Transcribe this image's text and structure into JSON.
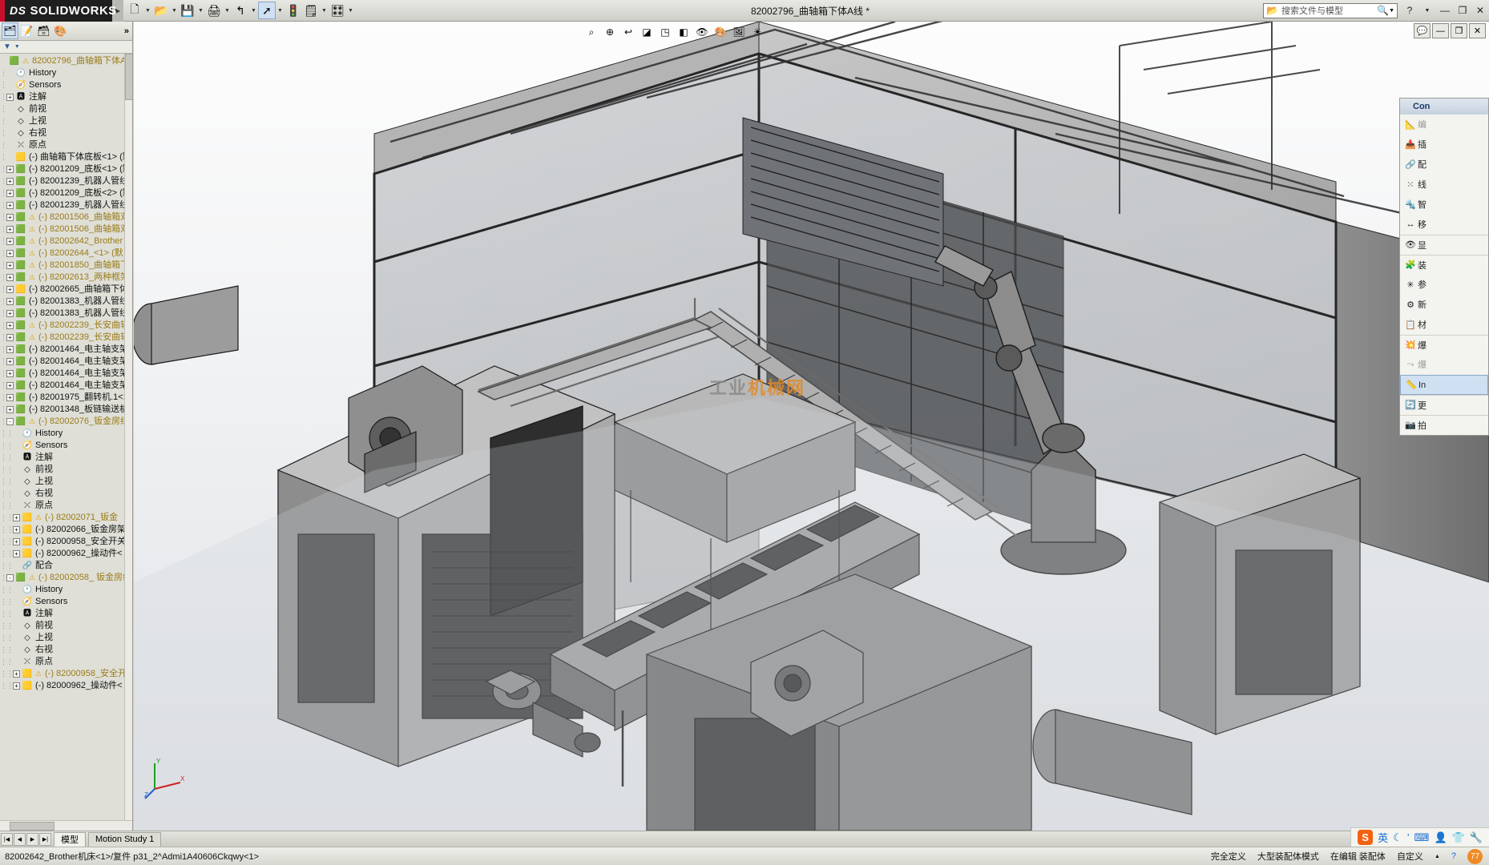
{
  "titlebar": {
    "brand": "SOLIDWORKS",
    "brand_ds": "DS",
    "document_title": "82002796_曲轴箱下体A线 *",
    "quick_tools": [
      {
        "name": "new-document",
        "glyph": "🗋"
      },
      {
        "name": "open-document",
        "glyph": "📂"
      },
      {
        "name": "save-document",
        "glyph": "💾"
      },
      {
        "name": "print-document",
        "glyph": "🖨"
      },
      {
        "name": "undo",
        "glyph": "↰"
      },
      {
        "name": "select",
        "glyph": "➚"
      },
      {
        "name": "rebuild",
        "glyph": "🚦"
      },
      {
        "name": "options",
        "glyph": "🗒"
      },
      {
        "name": "appearance",
        "glyph": "🎨"
      }
    ],
    "search_placeholder": "搜索文件与模型",
    "help_glyph": "?",
    "window_buttons": [
      "—",
      "❐",
      "✕"
    ]
  },
  "left_panel": {
    "tabs": [
      {
        "name": "feature-manager",
        "glyph": "🗂"
      },
      {
        "name": "property-manager",
        "glyph": "📝"
      },
      {
        "name": "configuration-manager",
        "glyph": "🗃"
      },
      {
        "name": "display-manager",
        "glyph": "🎨"
      }
    ],
    "more_label": "»",
    "filter_glyph": "▽"
  },
  "tree": [
    {
      "depth": 0,
      "expand": "",
      "icon": "assembly",
      "warn": true,
      "label": "82002796_曲轴箱下体A线",
      "amber": true
    },
    {
      "depth": 1,
      "expand": "",
      "icon": "history",
      "warn": false,
      "label": "History",
      "amber": false
    },
    {
      "depth": 1,
      "expand": "",
      "icon": "sensors",
      "warn": false,
      "label": "Sensors",
      "amber": false
    },
    {
      "depth": 1,
      "expand": "+",
      "icon": "annotations",
      "warn": false,
      "label": "注解",
      "amber": false
    },
    {
      "depth": 1,
      "expand": "",
      "icon": "plane",
      "warn": false,
      "label": "前视",
      "amber": false
    },
    {
      "depth": 1,
      "expand": "",
      "icon": "plane",
      "warn": false,
      "label": "上视",
      "amber": false
    },
    {
      "depth": 1,
      "expand": "",
      "icon": "plane",
      "warn": false,
      "label": "右视",
      "amber": false
    },
    {
      "depth": 1,
      "expand": "",
      "icon": "origin",
      "warn": false,
      "label": "原点",
      "amber": false
    },
    {
      "depth": 1,
      "expand": "",
      "icon": "part",
      "warn": false,
      "label": "(-) 曲轴箱下体底板<1>  (默",
      "amber": false
    },
    {
      "depth": 1,
      "expand": "+",
      "icon": "assembly",
      "warn": false,
      "label": "(-) 82001209_底板<1>  (默",
      "amber": false
    },
    {
      "depth": 1,
      "expand": "+",
      "icon": "assembly",
      "warn": false,
      "label": "(-) 82001239_机器人管线",
      "amber": false
    },
    {
      "depth": 1,
      "expand": "+",
      "icon": "assembly",
      "warn": false,
      "label": "(-) 82001209_底板<2>  (默",
      "amber": false
    },
    {
      "depth": 1,
      "expand": "+",
      "icon": "assembly",
      "warn": false,
      "label": "(-) 82001239_机器人管线",
      "amber": false
    },
    {
      "depth": 1,
      "expand": "+",
      "icon": "assembly",
      "warn": true,
      "label": "(-) 82001506_曲轴箱双",
      "amber": true
    },
    {
      "depth": 1,
      "expand": "+",
      "icon": "assembly",
      "warn": true,
      "label": "(-) 82001506_曲轴箱双",
      "amber": true
    },
    {
      "depth": 1,
      "expand": "+",
      "icon": "assembly",
      "warn": true,
      "label": "(-) 82002642_Brother",
      "amber": true
    },
    {
      "depth": 1,
      "expand": "+",
      "icon": "assembly",
      "warn": true,
      "label": "(-) 82002644_<1>  (默",
      "amber": true
    },
    {
      "depth": 1,
      "expand": "+",
      "icon": "assembly",
      "warn": true,
      "label": "(-) 82001850_曲轴箱下",
      "amber": true
    },
    {
      "depth": 1,
      "expand": "+",
      "icon": "assembly",
      "warn": true,
      "label": "(-) 82002613_两种框架",
      "amber": true
    },
    {
      "depth": 1,
      "expand": "+",
      "icon": "part",
      "warn": false,
      "label": "(-) 82002665_曲轴箱下体",
      "amber": false
    },
    {
      "depth": 1,
      "expand": "+",
      "icon": "assembly",
      "warn": false,
      "label": "(-) 82001383_机器人管线",
      "amber": false
    },
    {
      "depth": 1,
      "expand": "+",
      "icon": "assembly",
      "warn": false,
      "label": "(-) 82001383_机器人管线",
      "amber": false
    },
    {
      "depth": 1,
      "expand": "+",
      "icon": "assembly",
      "warn": true,
      "label": "(-) 82002239_长安曲轴",
      "amber": true
    },
    {
      "depth": 1,
      "expand": "+",
      "icon": "assembly",
      "warn": true,
      "label": "(-) 82002239_长安曲轴",
      "amber": true
    },
    {
      "depth": 1,
      "expand": "+",
      "icon": "assembly",
      "warn": false,
      "label": "(-) 82001464_电主轴支架",
      "amber": false
    },
    {
      "depth": 1,
      "expand": "+",
      "icon": "assembly",
      "warn": false,
      "label": "(-) 82001464_电主轴支架",
      "amber": false
    },
    {
      "depth": 1,
      "expand": "+",
      "icon": "assembly",
      "warn": false,
      "label": "(-) 82001464_电主轴支架",
      "amber": false
    },
    {
      "depth": 1,
      "expand": "+",
      "icon": "assembly",
      "warn": false,
      "label": "(-) 82001464_电主轴支架",
      "amber": false
    },
    {
      "depth": 1,
      "expand": "+",
      "icon": "assembly",
      "warn": false,
      "label": "(-) 82001975_翻转机.1<1",
      "amber": false
    },
    {
      "depth": 1,
      "expand": "+",
      "icon": "assembly",
      "warn": false,
      "label": "(-) 82001348_板链输送机",
      "amber": false
    },
    {
      "depth": 1,
      "expand": "-",
      "icon": "assembly",
      "warn": true,
      "label": "(-) 82002076_钣金房结",
      "amber": true
    },
    {
      "depth": 2,
      "expand": "",
      "icon": "history",
      "warn": false,
      "label": "History",
      "amber": false
    },
    {
      "depth": 2,
      "expand": "",
      "icon": "sensors",
      "warn": false,
      "label": "Sensors",
      "amber": false
    },
    {
      "depth": 2,
      "expand": "",
      "icon": "annotations",
      "warn": false,
      "label": "注解",
      "amber": false
    },
    {
      "depth": 2,
      "expand": "",
      "icon": "plane",
      "warn": false,
      "label": "前视",
      "amber": false
    },
    {
      "depth": 2,
      "expand": "",
      "icon": "plane",
      "warn": false,
      "label": "上视",
      "amber": false
    },
    {
      "depth": 2,
      "expand": "",
      "icon": "plane",
      "warn": false,
      "label": "右视",
      "amber": false
    },
    {
      "depth": 2,
      "expand": "",
      "icon": "origin",
      "warn": false,
      "label": "原点",
      "amber": false
    },
    {
      "depth": 2,
      "expand": "+",
      "icon": "part",
      "warn": true,
      "label": "(-) 82002071_钣金",
      "amber": true
    },
    {
      "depth": 2,
      "expand": "+",
      "icon": "part",
      "warn": false,
      "label": "(-) 82002066_钣金房架",
      "amber": false
    },
    {
      "depth": 2,
      "expand": "+",
      "icon": "part",
      "warn": false,
      "label": "(-) 82000958_安全开关",
      "amber": false
    },
    {
      "depth": 2,
      "expand": "+",
      "icon": "part",
      "warn": false,
      "label": "(-) 82000962_操动件<",
      "amber": false
    },
    {
      "depth": 2,
      "expand": "",
      "icon": "mates",
      "warn": false,
      "label": "配合",
      "amber": false
    },
    {
      "depth": 1,
      "expand": "-",
      "icon": "assembly",
      "warn": true,
      "label": "(-) 82002058_ 钣金房结",
      "amber": true
    },
    {
      "depth": 2,
      "expand": "",
      "icon": "history",
      "warn": false,
      "label": "History",
      "amber": false
    },
    {
      "depth": 2,
      "expand": "",
      "icon": "sensors",
      "warn": false,
      "label": "Sensors",
      "amber": false
    },
    {
      "depth": 2,
      "expand": "",
      "icon": "annotations",
      "warn": false,
      "label": "注解",
      "amber": false
    },
    {
      "depth": 2,
      "expand": "",
      "icon": "plane",
      "warn": false,
      "label": "前视",
      "amber": false
    },
    {
      "depth": 2,
      "expand": "",
      "icon": "plane",
      "warn": false,
      "label": "上视",
      "amber": false
    },
    {
      "depth": 2,
      "expand": "",
      "icon": "plane",
      "warn": false,
      "label": "右视",
      "amber": false
    },
    {
      "depth": 2,
      "expand": "",
      "icon": "origin",
      "warn": false,
      "label": "原点",
      "amber": false
    },
    {
      "depth": 2,
      "expand": "+",
      "icon": "part",
      "warn": true,
      "label": "(-) 82000958_安全开关",
      "amber": true
    },
    {
      "depth": 2,
      "expand": "+",
      "icon": "part",
      "warn": false,
      "label": "(-) 82000962_操动件<",
      "amber": false
    }
  ],
  "graphics": {
    "view_tools": [
      {
        "name": "zoom-to-fit",
        "glyph": "⌕"
      },
      {
        "name": "zoom-to-area",
        "glyph": "⊕"
      },
      {
        "name": "previous-view",
        "glyph": "↩"
      },
      {
        "name": "section-view",
        "glyph": "◪"
      },
      {
        "name": "view-orientation",
        "glyph": "◳"
      },
      {
        "name": "display-style",
        "glyph": "◧"
      },
      {
        "name": "hide-show-items",
        "glyph": "👁"
      },
      {
        "name": "edit-appearance",
        "glyph": "🎨"
      },
      {
        "name": "apply-scene",
        "glyph": "🖼"
      },
      {
        "name": "view-settings",
        "glyph": "☀"
      }
    ],
    "confirm_corner": [
      {
        "name": "confirm-ok",
        "glyph": "✔"
      },
      {
        "name": "minimize-window",
        "glyph": "—"
      },
      {
        "name": "restore-window",
        "glyph": "❐"
      },
      {
        "name": "close-window",
        "glyph": "✕"
      }
    ],
    "watermark": "机械网",
    "watermark_prefix": "工业"
  },
  "context_menu": {
    "title": "Con",
    "items": [
      {
        "name": "edit-component",
        "label": "编",
        "icon": "edit-icon",
        "state": "dim"
      },
      {
        "name": "insert-components",
        "label": "插",
        "icon": "insert-icon",
        "state": ""
      },
      {
        "name": "mate",
        "label": "配",
        "icon": "mate-icon",
        "state": ""
      },
      {
        "name": "linear-pattern",
        "label": "线",
        "icon": "pattern-icon",
        "state": ""
      },
      {
        "name": "smart-fasteners",
        "label": "智",
        "icon": "fastener-icon",
        "state": ""
      },
      {
        "name": "move-component",
        "label": "移",
        "icon": "move-icon",
        "state": ""
      },
      {
        "name": "show-hidden",
        "label": "显",
        "icon": "show-icon",
        "state": "sep"
      },
      {
        "name": "assembly-features",
        "label": "装",
        "icon": "assembly-feature-icon",
        "state": "sep"
      },
      {
        "name": "reference-geometry",
        "label": "参",
        "icon": "reference-icon",
        "state": ""
      },
      {
        "name": "new-motion-study",
        "label": "新",
        "icon": "motion-icon",
        "state": ""
      },
      {
        "name": "bill-of-materials",
        "label": "材",
        "icon": "bom-icon",
        "state": ""
      },
      {
        "name": "exploded-view",
        "label": "爆",
        "icon": "explode-icon",
        "state": "sep"
      },
      {
        "name": "explode-line-sketch",
        "label": "爆",
        "icon": "explode-line-icon",
        "state": "dim"
      },
      {
        "name": "instant3d",
        "label": "In",
        "icon": "instant3d-icon",
        "state": "hl"
      },
      {
        "name": "update-components",
        "label": "更",
        "icon": "update-icon",
        "state": "sep"
      },
      {
        "name": "take-snapshot",
        "label": "拍",
        "icon": "snapshot-icon",
        "state": "sep"
      }
    ]
  },
  "bottom": {
    "nav_buttons": [
      "|◀",
      "◀",
      "▶",
      "▶|"
    ],
    "tabs": [
      {
        "name": "tab-model",
        "label": "模型",
        "active": true
      },
      {
        "name": "tab-motion-study",
        "label": "Motion Study 1",
        "active": false
      }
    ],
    "status_left": "82002642_Brother机床<1>/复件 p31_2^Admi1A40606Ckqwy<1>",
    "status_items": [
      "完全定义",
      "大型装配体模式",
      "在编辑 装配体"
    ],
    "status_custom": "自定义",
    "status_help": "?",
    "status_badge": "77"
  },
  "ime": {
    "app": "S",
    "mode": "英",
    "icons": [
      {
        "name": "moon-icon",
        "glyph": "☾"
      },
      {
        "name": "comma-icon",
        "glyph": "’"
      },
      {
        "name": "keyboard-icon",
        "glyph": "⌨"
      },
      {
        "name": "user-icon",
        "glyph": "👤"
      },
      {
        "name": "skin-icon",
        "glyph": "👕"
      },
      {
        "name": "tools-icon",
        "glyph": "🔧"
      }
    ]
  }
}
